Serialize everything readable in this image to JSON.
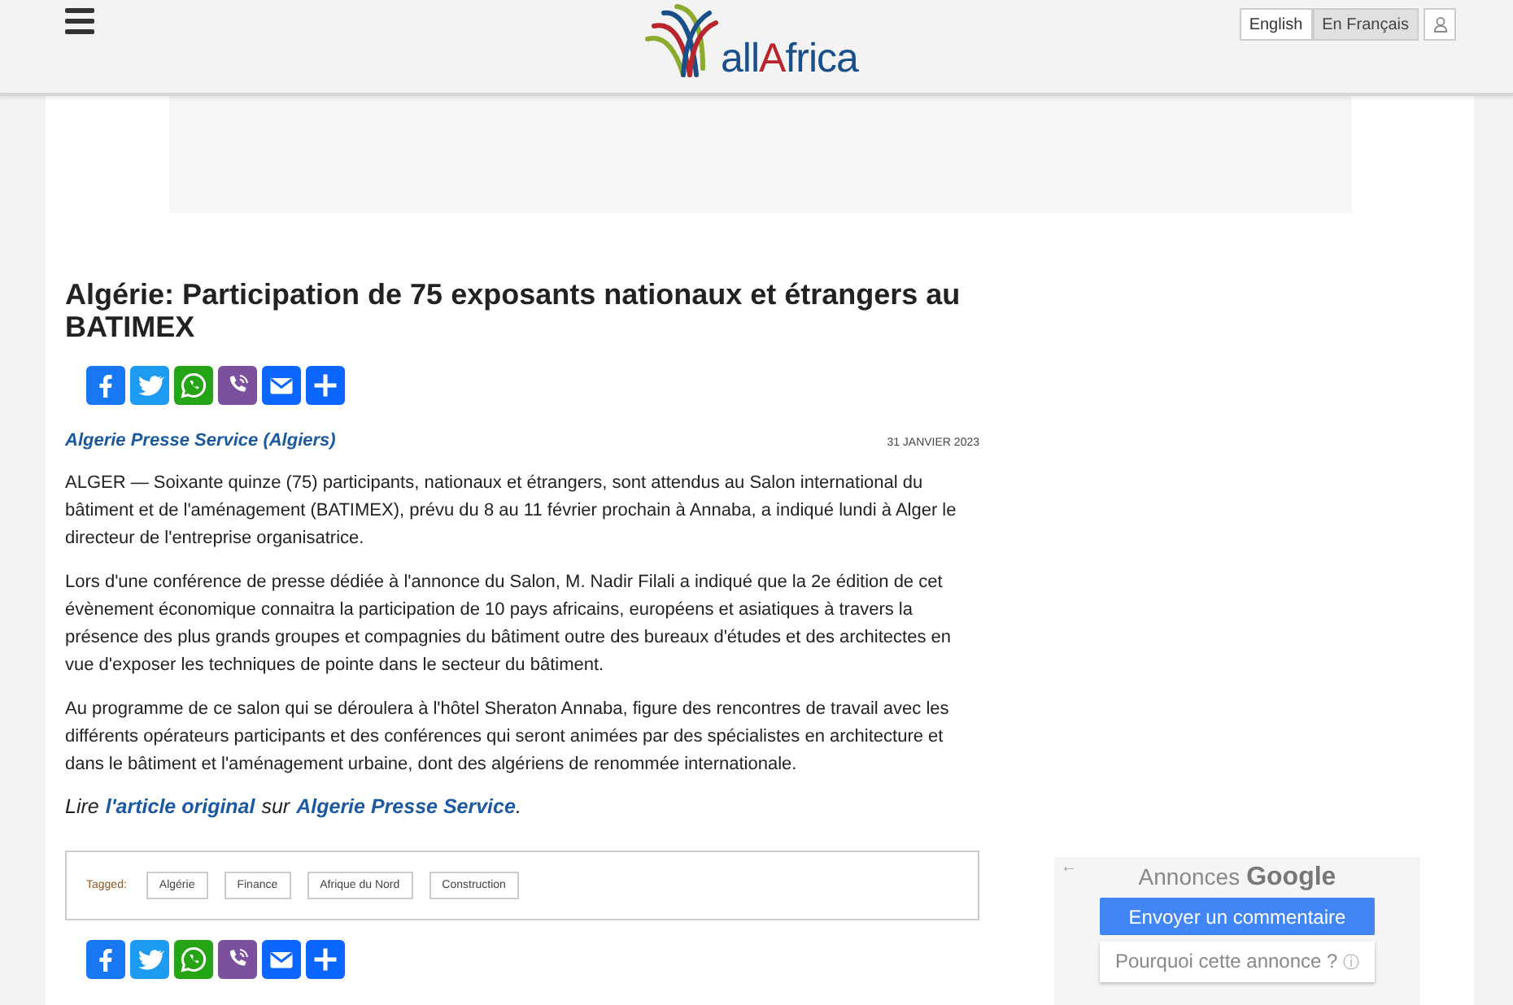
{
  "header": {
    "logo": [
      {
        "text": "all",
        "accent": false
      },
      {
        "text": "A",
        "accent": true
      },
      {
        "text": "frica",
        "accent": false
      }
    ],
    "languages": [
      {
        "label": "English",
        "selected": false
      },
      {
        "label": "En Français",
        "selected": true
      }
    ]
  },
  "article": {
    "title": "Algérie: Participation de 75 exposants nationaux et étrangers au BATIMEX",
    "share_top": [
      {
        "kind": "facebook"
      },
      {
        "kind": "twitter"
      },
      {
        "kind": "whatsapp"
      },
      {
        "kind": "viber"
      },
      {
        "kind": "email"
      },
      {
        "kind": "more"
      }
    ],
    "source": "Algerie Presse Service (Algiers)",
    "date": "31 JANVIER 2023",
    "paragraphs": [
      "ALGER — Soixante quinze (75) participants, nationaux et étrangers, sont attendus au Salon international du bâtiment et de l'aménagement (BATIMEX), prévu du 8 au 11 février prochain à Annaba, a indiqué lundi à Alger le directeur de l'entreprise organisatrice.",
      "Lors d'une conférence de presse dédiée à l'annonce du Salon, M. Nadir Filali a indiqué que la 2e édition de cet évènement économique connaitra la participation de 10 pays africains, européens et asiatiques à travers la présence des plus grands groupes et compagnies du bâtiment outre des bureaux d'études et des architectes en vue d'exposer les techniques de pointe dans le secteur du bâtiment.",
      "Au programme de ce salon qui se déroulera à l'hôtel Sheraton Annaba, figure des rencontres de travail avec les différents opérateurs participants et des conférences qui seront animées par des spécialistes en architecture et dans le bâtiment et l'aménagement urbaine, dont des algériens de renommée internationale."
    ],
    "read_more": {
      "prefix": "Lire",
      "link": "l'article original",
      "middle": "sur",
      "source_link": "Algerie Presse Service",
      "suffix": "."
    },
    "tags_label": "Tagged:",
    "tags": [
      "Algérie",
      "Finance",
      "Afrique du Nord",
      "Construction"
    ],
    "share_bottom": [
      {
        "kind": "facebook"
      },
      {
        "kind": "twitter"
      },
      {
        "kind": "whatsapp"
      },
      {
        "kind": "viber"
      },
      {
        "kind": "email"
      },
      {
        "kind": "more"
      }
    ]
  },
  "ad": {
    "back": "←",
    "label": "Annonces",
    "brand": "Google",
    "feedback_button": "Envoyer un commentaire",
    "why_button": "Pourquoi cette annonce ?",
    "info": "ⓘ"
  }
}
